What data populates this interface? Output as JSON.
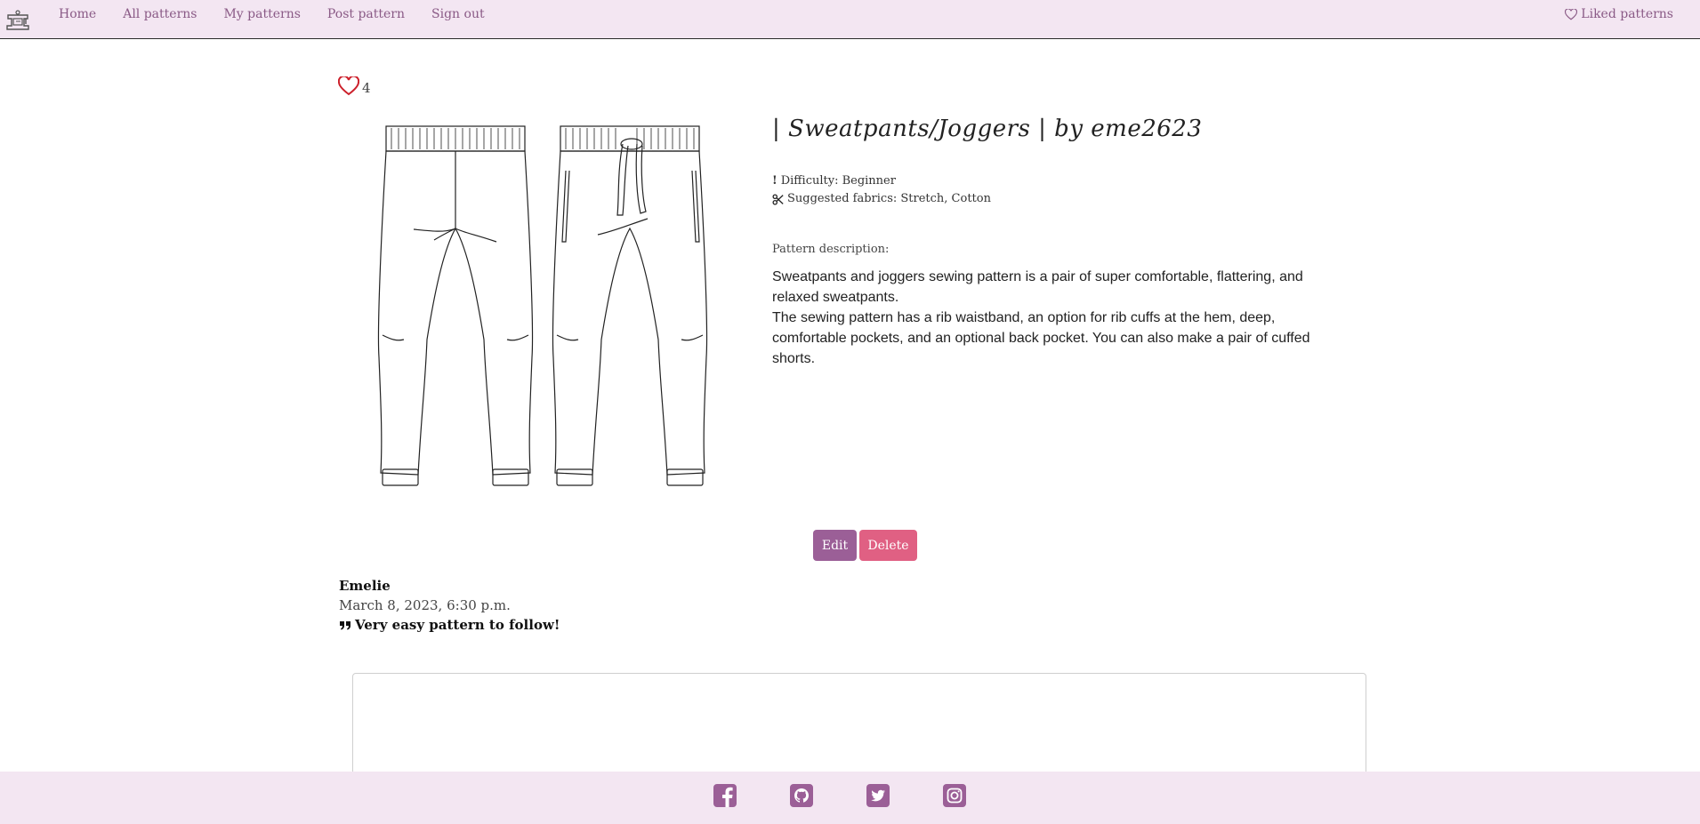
{
  "nav": {
    "logo_icon": "sewing-machine-icon",
    "links": [
      {
        "label": "Home"
      },
      {
        "label": "All patterns"
      },
      {
        "label": "My patterns"
      },
      {
        "label": "Post pattern"
      },
      {
        "label": "Sign out"
      }
    ],
    "liked_label": "Liked patterns",
    "liked_icon": "heart-outline-icon"
  },
  "pattern": {
    "like_count": "4",
    "title": "| Sweatpants/Joggers | by eme2623",
    "difficulty_prefix": "!",
    "difficulty": "Difficulty: Beginner",
    "fabrics": "Suggested fabrics: Stretch, Cotton",
    "description_label": "Pattern description:",
    "description_lines": [
      "Sweatpants and joggers sewing pattern is a pair of super comfortable, flattering, and relaxed sweatpants.",
      "The sewing pattern has a rib waistband, an option for rib cuffs at the hem, deep, comfortable pockets, and an optional back pocket. You can also make a pair of cuffed shorts."
    ],
    "image_icon": "sweatpants-illustration"
  },
  "actions": {
    "edit_label": "Edit",
    "delete_label": "Delete"
  },
  "comment": {
    "author": "Emelie",
    "date": "March 8, 2023, 6:30 p.m.",
    "body": "Very easy pattern to follow!",
    "quote_icon": "quote-icon"
  },
  "footer": {
    "icons": [
      "facebook-icon",
      "github-icon",
      "twitter-icon",
      "instagram-icon"
    ]
  },
  "colors": {
    "nav_bg": "#f3e6f2",
    "accent": "#9b5f97",
    "delete": "#e06083",
    "heart": "#cc1f2a"
  }
}
